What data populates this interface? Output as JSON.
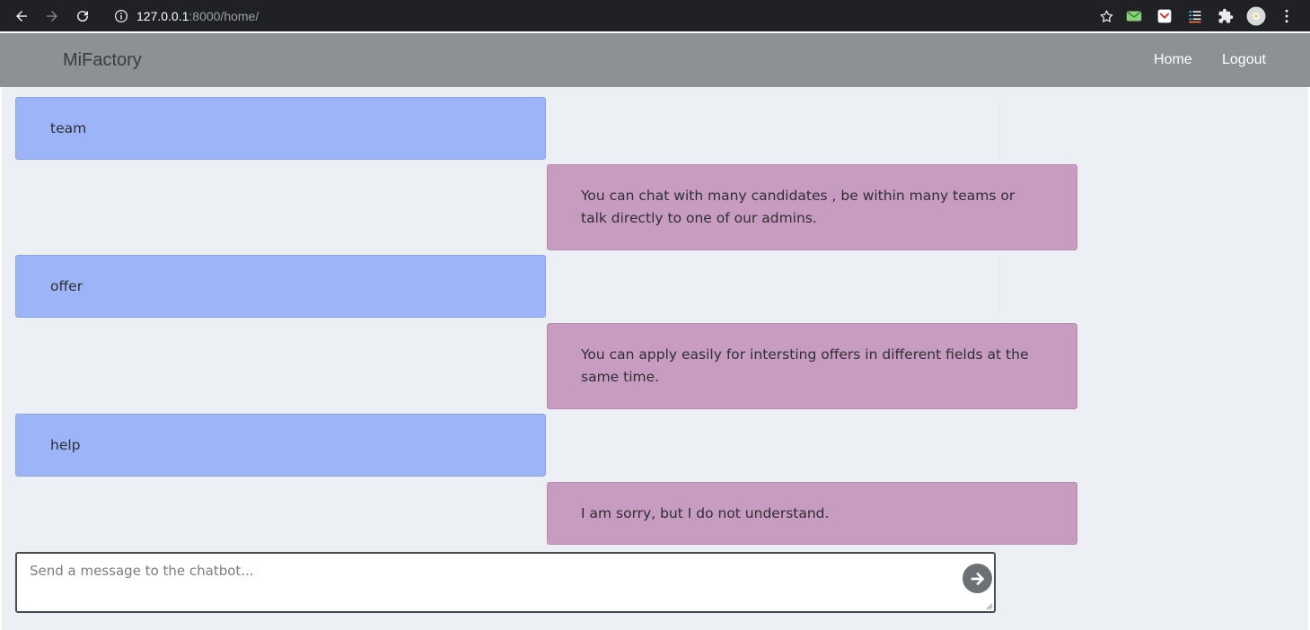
{
  "browser": {
    "url_host": "127.0.0.1",
    "url_path": ":8000/home/"
  },
  "navbar": {
    "brand": "MiFactory",
    "links": [
      "Home",
      "Logout"
    ]
  },
  "chat": {
    "messages": [
      {
        "sender": "user",
        "text": "team"
      },
      {
        "sender": "bot",
        "text": "You can chat with many candidates , be within many teams or talk directly to one of our admins."
      },
      {
        "sender": "user",
        "text": "offer"
      },
      {
        "sender": "bot",
        "text": "You can apply easily for intersting offers in different fields at the same time."
      },
      {
        "sender": "user",
        "text": "help"
      },
      {
        "sender": "bot",
        "text": "I am sorry, but I do not understand."
      }
    ],
    "input_placeholder": "Send a message to the chatbot...",
    "input_value": ""
  },
  "colors": {
    "user_bubble": "#9db5f8",
    "bot_bubble": "#c89cc0",
    "navbar": "#8d9194",
    "background": "#ecf0f4"
  }
}
